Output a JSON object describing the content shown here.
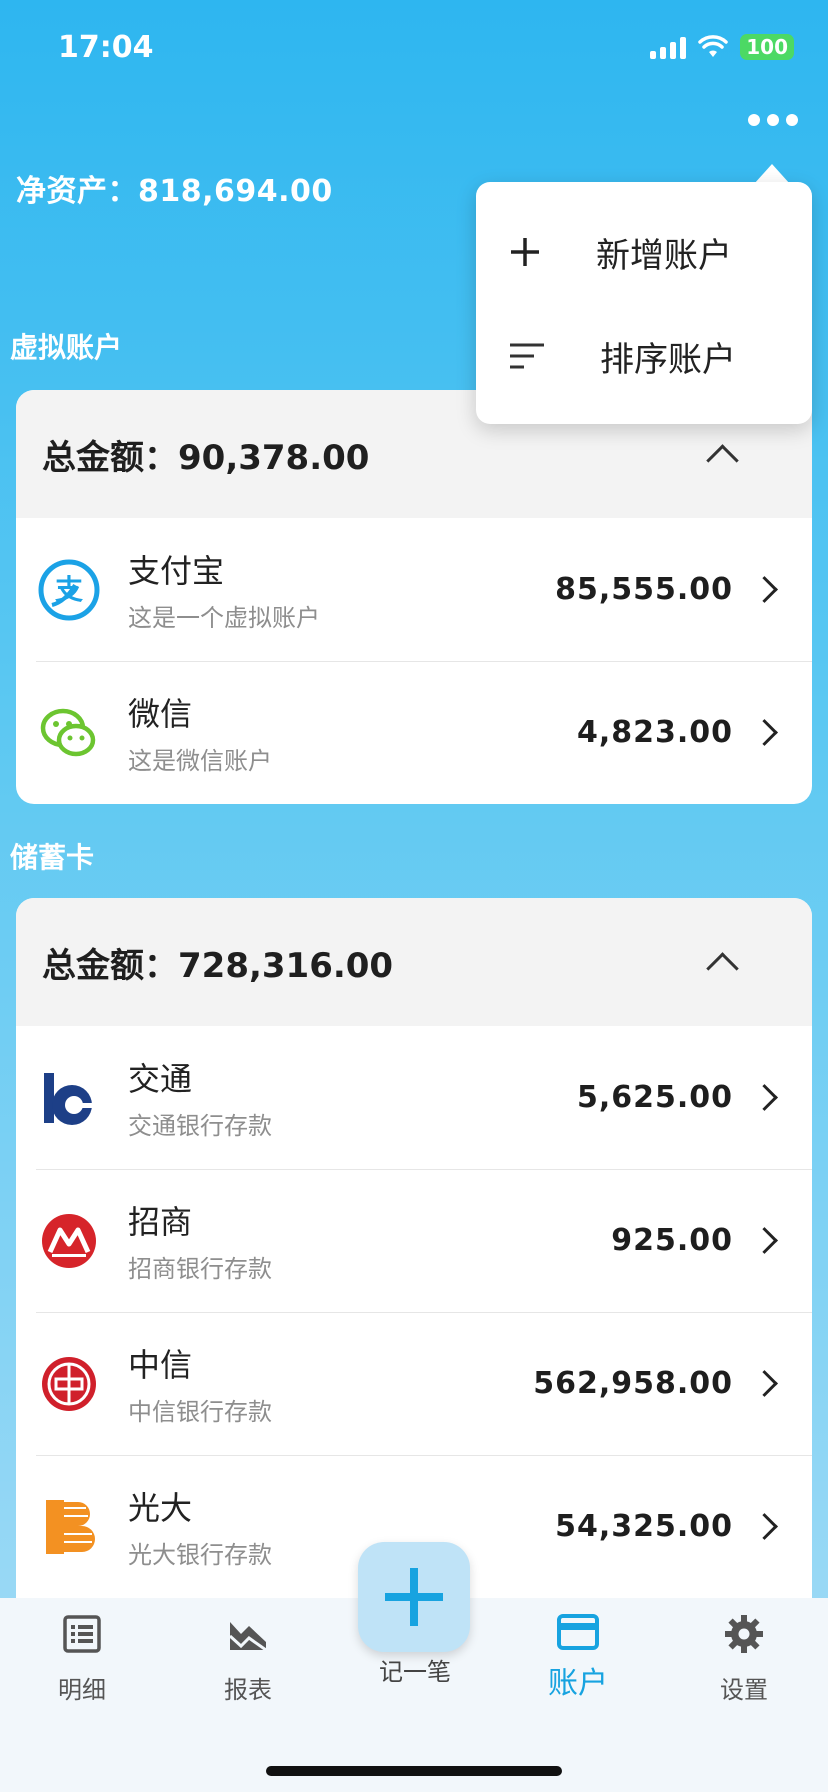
{
  "status_bar": {
    "time": "17:04",
    "battery": "100"
  },
  "header": {
    "net_assets_label": "净资产：",
    "net_assets_value": "818,694.00"
  },
  "menu": {
    "items": [
      {
        "label": "新增账户",
        "icon": "plus-icon"
      },
      {
        "label": "排序账户",
        "icon": "sort-icon"
      }
    ]
  },
  "sections": [
    {
      "title": "虚拟账户",
      "total_label": "总金额：",
      "total": "90,378.00",
      "accounts": [
        {
          "name": "支付宝",
          "desc": "这是一个虚拟账户",
          "amount": "85,555.00",
          "icon": "alipay-icon"
        },
        {
          "name": "微信",
          "desc": "这是微信账户",
          "amount": "4,823.00",
          "icon": "wechat-icon"
        }
      ]
    },
    {
      "title": "储蓄卡",
      "total_label": "总金额：",
      "total": "728,316.00",
      "accounts": [
        {
          "name": "交通",
          "desc": "交通银行存款",
          "amount": "5,625.00",
          "icon": "bocom-icon"
        },
        {
          "name": "招商",
          "desc": "招商银行存款",
          "amount": "925.00",
          "icon": "cmb-icon"
        },
        {
          "name": "中信",
          "desc": "中信银行存款",
          "amount": "562,958.00",
          "icon": "citic-icon"
        },
        {
          "name": "光大",
          "desc": "光大银行存款",
          "amount": "54,325.00",
          "icon": "ceb-icon"
        }
      ]
    }
  ],
  "tabs": [
    {
      "label": "明细",
      "icon": "list-icon"
    },
    {
      "label": "报表",
      "icon": "chart-icon"
    },
    {
      "label": "账户",
      "icon": "card-icon",
      "active": true
    },
    {
      "label": "设置",
      "icon": "gear-icon"
    }
  ],
  "fab": {
    "label": "记一笔"
  },
  "colors": {
    "accent": "#17a3e0",
    "alipay": "#1ba2e6",
    "wechat": "#6cc530",
    "bocom": "#1d3f87",
    "cmb": "#d6242a",
    "citic": "#d0202b",
    "ceb": "#f39122"
  }
}
